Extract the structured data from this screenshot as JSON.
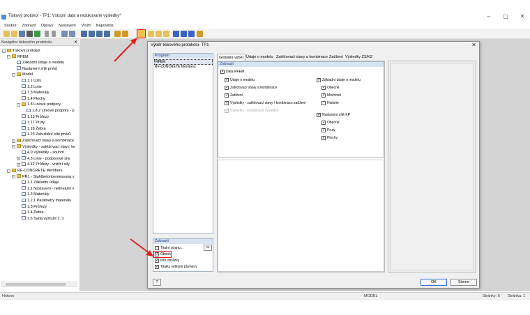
{
  "window": {
    "title": "Tiskový protokol - TP1: Vstupní data a redukované výsledky*"
  },
  "menu": [
    "Soubor",
    "Zobrazit",
    "Úpravy",
    "Nastavení",
    "Vložit",
    "Nápověda"
  ],
  "navigator": {
    "title": "Navigátor tiskového protokolu",
    "items": [
      "Tiskový protokol",
      "RFEM",
      "Základní údaje o modelu",
      "Nastavení sítě prvků",
      "Model",
      "1.1 Uzly",
      "1.2 Linie",
      "1.3 Materiály",
      "1.4 Plochy",
      "1.8 Liniové podpory",
      "1.8.2 Liniové podpory - p",
      "1.13 Průřezy",
      "1.17 Pruty",
      "1.18 Žebra",
      "1.23 Zahuštění sítě prvků",
      "Zatěžovací stavy a kombinace",
      "Výsledky - zatěžovací stavy, ko",
      "4.0 Výsledky - souhrn",
      "4.3 Linie - podporové síly",
      "4.12 Průřezy - vnitřní síly",
      "RF-CONCRETE Members",
      "PŘ1 - Stahlbetonbemessung v",
      "1.1 Základní údaje",
      "1.1 Nastavení - nelineární v",
      "1.2 Materiály",
      "1.2.1 Parametry materiálu",
      "1.3 Průřezy",
      "1.4 Žebra",
      "1.6 Sada výztuže č. 1"
    ]
  },
  "dialog": {
    "title": "Výběr tiskového protokolu- TP1",
    "close": "✕",
    "program_header": "Program",
    "programs": [
      "RFEM",
      "RF-CONCRETE Members"
    ],
    "display_header": "Zobrazit",
    "display_options": [
      {
        "label": "Titulní stranu...",
        "checked": false
      },
      {
        "label": "Obsah",
        "checked": true
      },
      {
        "label": "Info obrázky",
        "checked": true
      },
      {
        "label": "Titulky velkými písmeny",
        "checked": true
      }
    ],
    "tabs": [
      "Globální výběr",
      "Údaje o modelu",
      "Zatěžovací stavy a kombinace",
      "Zatížení",
      "Výsledky ZS/KZ"
    ],
    "show_header": "Zobrazit",
    "data_rfem": "Data RFEM",
    "left_options": [
      {
        "label": "Údaje o modelu",
        "checked": true,
        "disabled": false
      },
      {
        "label": "Zatěžovací stavy a kombinace",
        "checked": true,
        "disabled": false
      },
      {
        "label": "Zatížení",
        "checked": true,
        "disabled": false
      },
      {
        "label": "Výsledky - zatěžovací stavy / kombinace zatížení",
        "checked": true,
        "disabled": false
      },
      {
        "label": "Výsledky - kombinace výsledků",
        "checked": true,
        "disabled": true
      }
    ],
    "model_header": "Základní údaje o modelu",
    "model_options": [
      {
        "label": "Obecné",
        "checked": true
      },
      {
        "label": "Možnosti",
        "checked": true
      },
      {
        "label": "Historie",
        "checked": false
      }
    ],
    "mesh_header": "Nastavení sítě KP",
    "mesh_options": [
      {
        "label": "Obecné",
        "checked": true
      },
      {
        "label": "Pruty",
        "checked": true
      },
      {
        "label": "Plochy",
        "checked": true
      }
    ],
    "ok": "OK",
    "cancel": "Storno",
    "check": "✓"
  },
  "status": {
    "left": "Hotovo",
    "mode": "MODEL",
    "pages": "Stránky: 6",
    "page": "Stránka: 1"
  },
  "colors": {
    "accent": "#2a6ad8",
    "highlight_red": "#e02020",
    "panel_header": "#d7e3f2"
  }
}
